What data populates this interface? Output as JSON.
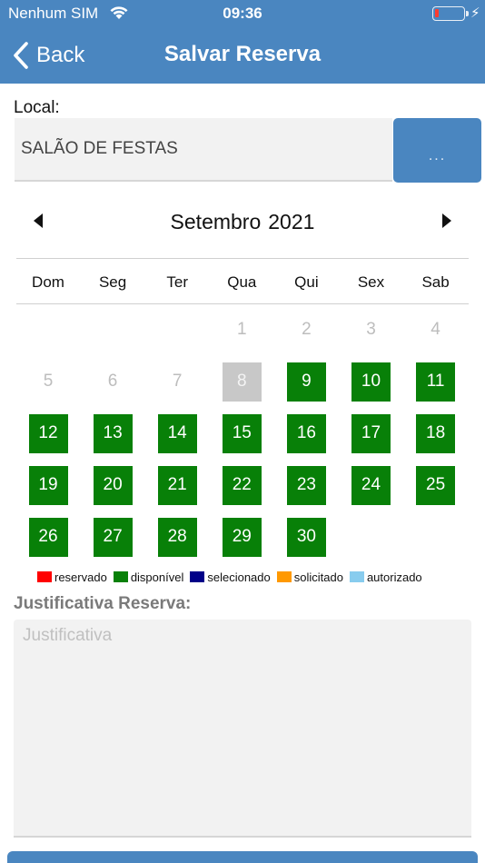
{
  "status_bar": {
    "carrier": "Nenhum SIM",
    "time": "09:36",
    "battery_level_percent": 12
  },
  "nav": {
    "back_label": "Back",
    "title": "Salvar Reserva"
  },
  "local": {
    "label": "Local:",
    "value": "SALÃO DE FESTAS",
    "pick_label": "..."
  },
  "calendar": {
    "month": "Setembro",
    "year": "2021",
    "weekdays": [
      "Dom",
      "Seg",
      "Ter",
      "Qua",
      "Qui",
      "Sex",
      "Sab"
    ],
    "first_weekday_index": 3,
    "days_in_month": 30,
    "today": 8,
    "available_days": [
      9,
      10,
      11,
      12,
      13,
      14,
      15,
      16,
      17,
      18,
      19,
      20,
      21,
      22,
      23,
      24,
      25,
      26,
      27,
      28,
      29,
      30
    ],
    "colors": {
      "available": "#088008",
      "past": "#bdbdbd",
      "today": "#c8c8c8"
    }
  },
  "legend": [
    {
      "label": "reservado",
      "color": "#ff0000"
    },
    {
      "label": "disponível",
      "color": "#088008"
    },
    {
      "label": "selecionado",
      "color": "#000088"
    },
    {
      "label": "solicitado",
      "color": "#ff9900"
    },
    {
      "label": "autorizado",
      "color": "#88ccee"
    }
  ],
  "justificativa": {
    "label": "Justificativa Reserva:",
    "placeholder": "Justificativa",
    "value": ""
  },
  "colors": {
    "primary": "#4a86c0"
  }
}
